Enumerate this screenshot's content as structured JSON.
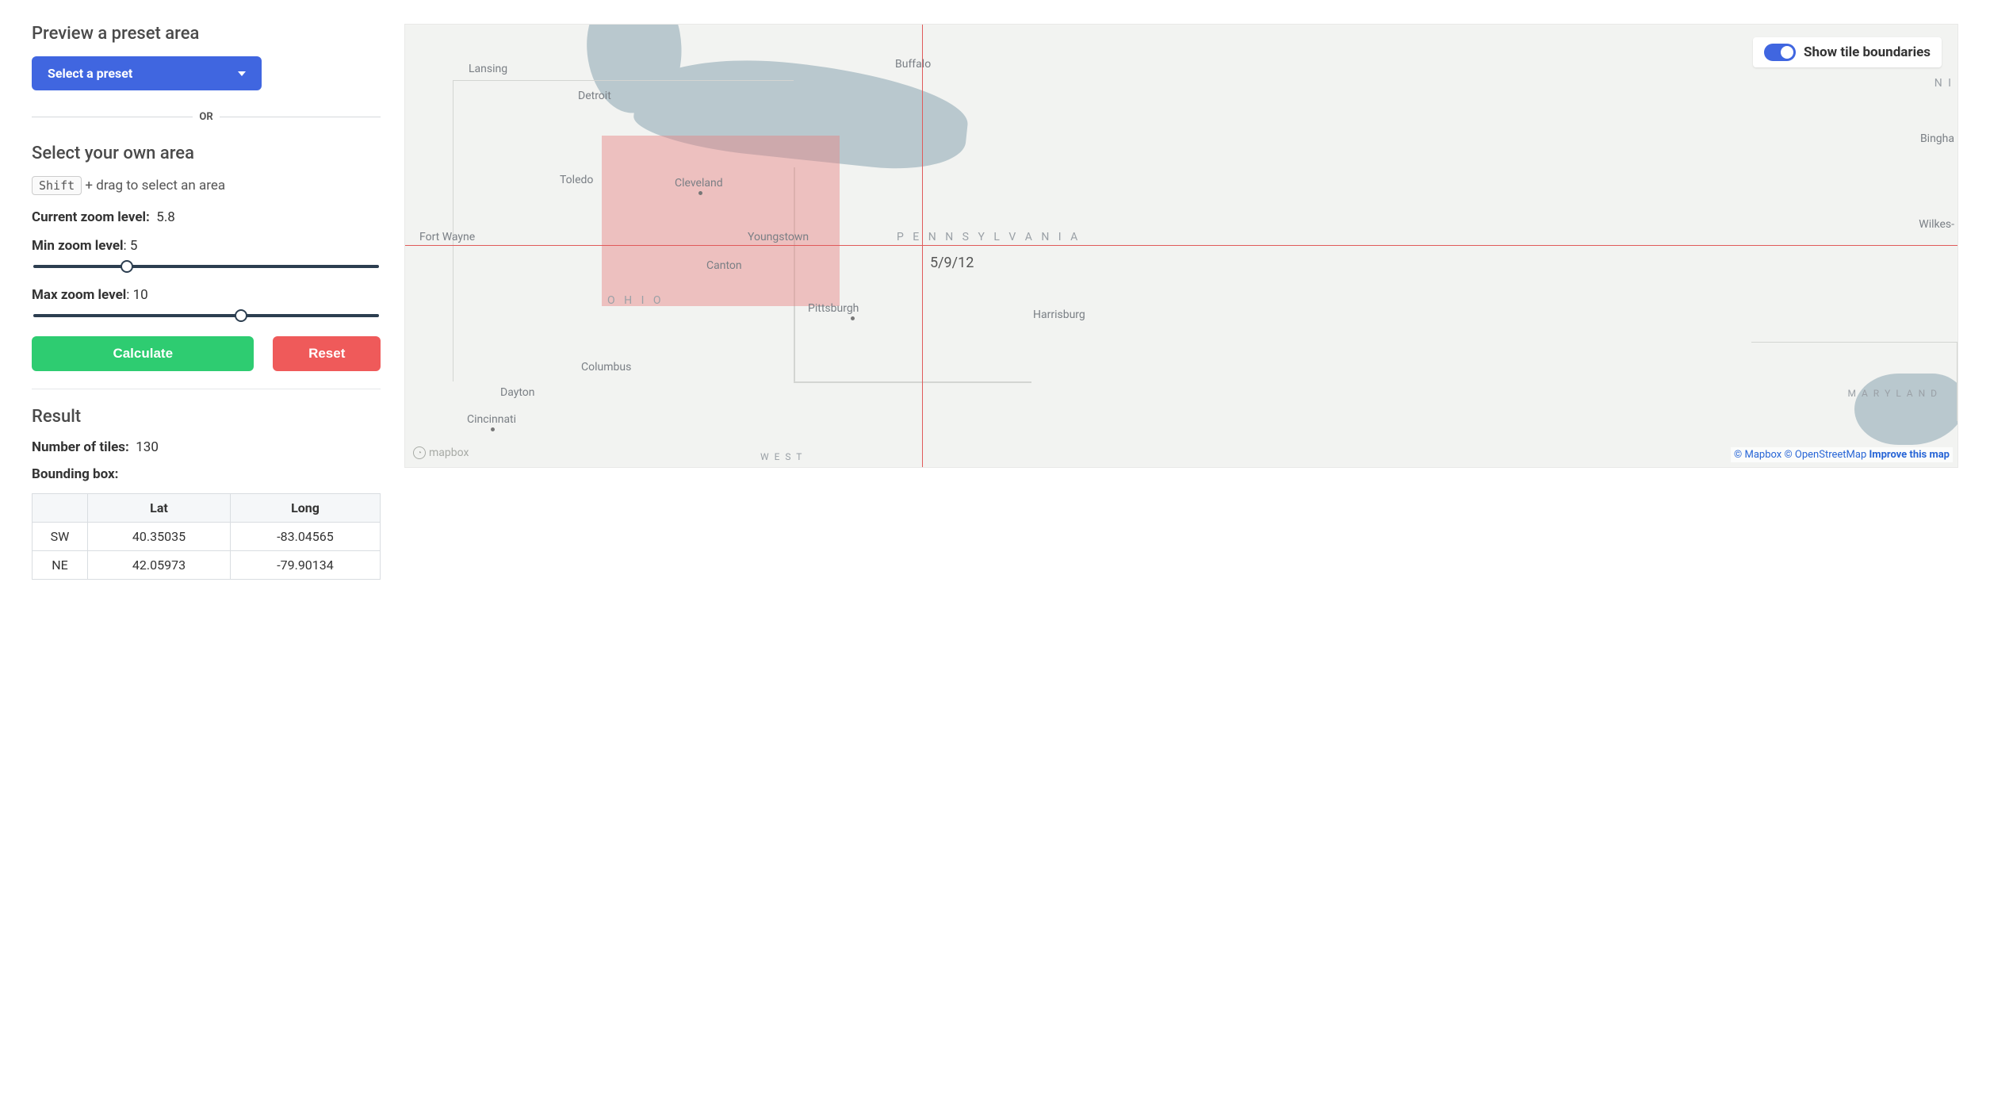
{
  "preset": {
    "heading": "Preview a preset area",
    "select_label": "Select a preset"
  },
  "or_label": "OR",
  "own_area": {
    "heading": "Select your own area",
    "shift_key": "Shift",
    "hint_suffix": " + drag to select an area"
  },
  "zoom": {
    "current_label": "Current zoom level:",
    "current_value": "5.8",
    "min_label": "Min zoom level",
    "min_value": "5",
    "max_label": "Max zoom level",
    "max_value": "10",
    "min_thumb_pct": "27%",
    "max_thumb_pct": "60%"
  },
  "buttons": {
    "calculate": "Calculate",
    "reset": "Reset"
  },
  "result": {
    "heading": "Result",
    "tiles_label": "Number of tiles:",
    "tiles_value": "130",
    "bbox_label": "Bounding box:",
    "headers": {
      "lat": "Lat",
      "long": "Long"
    },
    "sw": {
      "name": "SW",
      "lat": "40.35035",
      "long": "-83.04565"
    },
    "ne": {
      "name": "NE",
      "lat": "42.05973",
      "long": "-79.90134"
    }
  },
  "map": {
    "toggle_label": "Show tile boundaries",
    "tile_coord": "5/9/12",
    "logo_text": "mapbox",
    "attribution": {
      "mapbox": "© Mapbox",
      "osm": "© OpenStreetMap",
      "improve": "Improve this map"
    },
    "cities": {
      "lansing": "Lansing",
      "detroit": "Detroit",
      "toledo": "Toledo",
      "cleveland": "Cleveland",
      "youngstown": "Youngstown",
      "canton": "Canton",
      "fortwayne": "Fort Wayne",
      "columbus": "Columbus",
      "dayton": "Dayton",
      "cincinnati": "Cincinnati",
      "pittsburgh": "Pittsburgh",
      "harrisburg": "Harrisburg",
      "buffalo": "Buffalo",
      "bingha": "Bingha",
      "wilkes": "Wilkes-"
    },
    "states": {
      "ohio": "O H I O",
      "pennsylvania": "P E N N S Y L V A N I A",
      "maryland": "M A R Y L A N D",
      "west_virginia": "W E S T",
      "ni": "N I"
    }
  }
}
